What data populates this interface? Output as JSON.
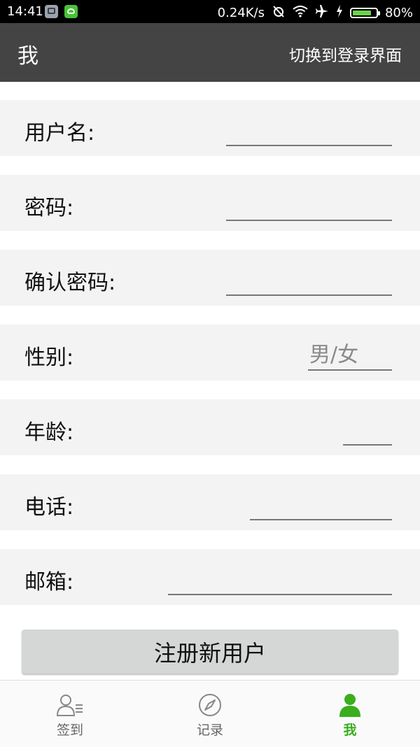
{
  "status_bar": {
    "time": "14:41",
    "network_speed": "0.24K/s",
    "battery": "80%",
    "battery_level": 0.8
  },
  "header": {
    "title": "我",
    "switch_label": "切换到登录界面"
  },
  "form": {
    "username_label": "用户名:",
    "password_label": "密码:",
    "confirm_label": "确认密码:",
    "gender_label": "性别:",
    "gender_placeholder": "男/女",
    "age_label": "年龄:",
    "phone_label": "电话:",
    "email_label": "邮箱:",
    "submit_label": "注册新用户"
  },
  "nav": {
    "checkin_label": "签到",
    "records_label": "记录",
    "me_label": "我"
  },
  "colors": {
    "accent": "#3aae1f",
    "header_bg": "#444444"
  }
}
